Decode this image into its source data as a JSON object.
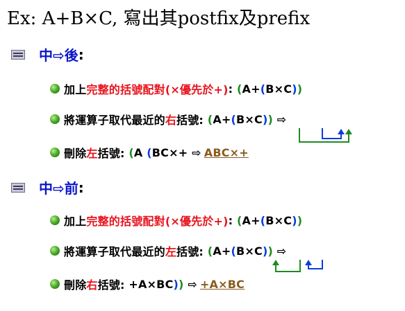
{
  "title": "Ex: A+B×C, 寫出其postfix及prefix",
  "postfix": {
    "heading": "中⇨後",
    "colon": ":",
    "step1": {
      "a": "加上",
      "b": "完整的括號配對",
      "c": " (×優先於+)",
      "d": ": ",
      "e": "(",
      "f": "A+",
      "g": "(",
      "h": "B×C",
      "i": ")",
      "j": ")"
    },
    "step2": {
      "a": "將運算子取代最近的",
      "b": "右",
      "c": "括號: ",
      "d": "(",
      "e": "A+",
      "f": "(",
      "g": "B×C",
      "h": ")",
      "i": ")",
      "j": " ⇨"
    },
    "step3": {
      "a": "刪除",
      "b": "左",
      "c": "括號: ",
      "d": "(",
      "e": "A ",
      "f": "(",
      "g": "BC×+",
      "h": " ⇨",
      "i": "ABC×+"
    }
  },
  "prefix": {
    "heading": "中⇨前",
    "colon": ":",
    "step1": {
      "a": "加上",
      "b": "完整的括號配對",
      "c": " (×優先於+)",
      "d": ": ",
      "e": "(",
      "f": "A+",
      "g": "(",
      "h": "B×C",
      "i": ")",
      "j": ")"
    },
    "step2": {
      "a": "將運算子取代最近的",
      "b": "左",
      "c": "括號: ",
      "d": "(",
      "e": "A+",
      "f": "(",
      "g": "B×C",
      "h": ")",
      "i": ")",
      "j": " ⇨"
    },
    "step3": {
      "a": "刪除",
      "b": "右",
      "c": "括號: ",
      "d": "+A×BC",
      "e": ")",
      "f": ")",
      "g": " ⇨",
      "h": "+A×BC"
    }
  },
  "colors": {
    "heading": "#0a16c8",
    "emphasis": "#e8141e",
    "outer_paren": "#1f8a1f",
    "inner_paren": "#0a3cd8",
    "result": "#8a5b1e"
  },
  "icons": [
    "section-bullet-icon",
    "green-ball-bullet-icon",
    "bracket-arrow-icon"
  ]
}
